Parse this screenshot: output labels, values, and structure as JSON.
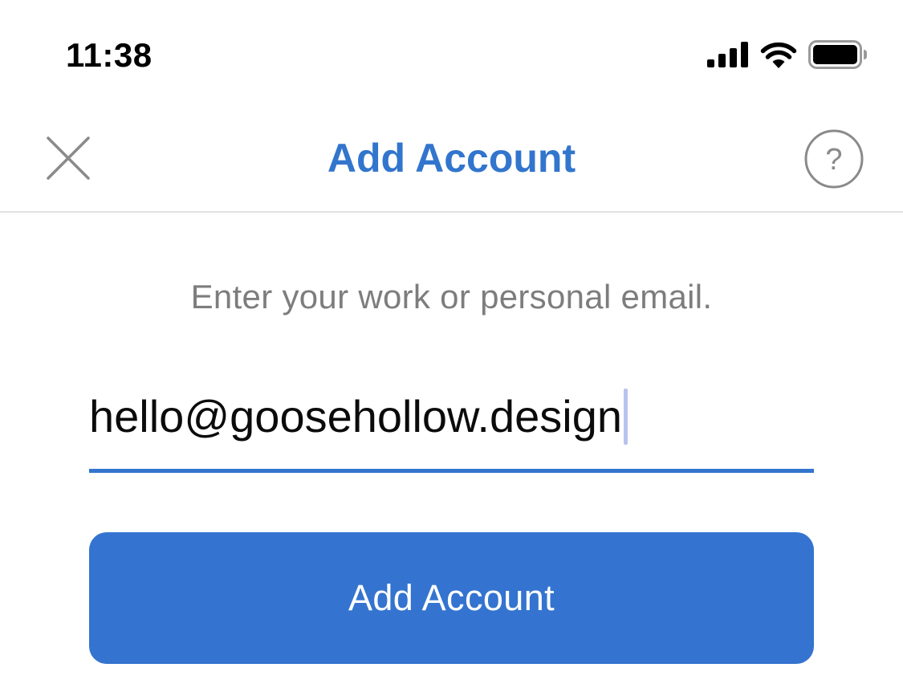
{
  "status_bar": {
    "time": "11:38",
    "icons": [
      "cellular-signal-icon",
      "wifi-icon",
      "battery-icon"
    ]
  },
  "nav": {
    "title": "Add Account",
    "close_icon": "close-icon",
    "help_icon": "help-icon",
    "help_glyph": "?"
  },
  "form": {
    "prompt": "Enter your work or personal email.",
    "email_value": "hello@goosehollow.design",
    "submit_label": "Add Account"
  },
  "colors": {
    "accent": "#3275cd",
    "button": "#3474d0",
    "prompt_text": "#7d7d7d",
    "divider": "#e1e1e1",
    "icon_gray": "#8a8a8a",
    "caret": "#b9c3ef"
  }
}
